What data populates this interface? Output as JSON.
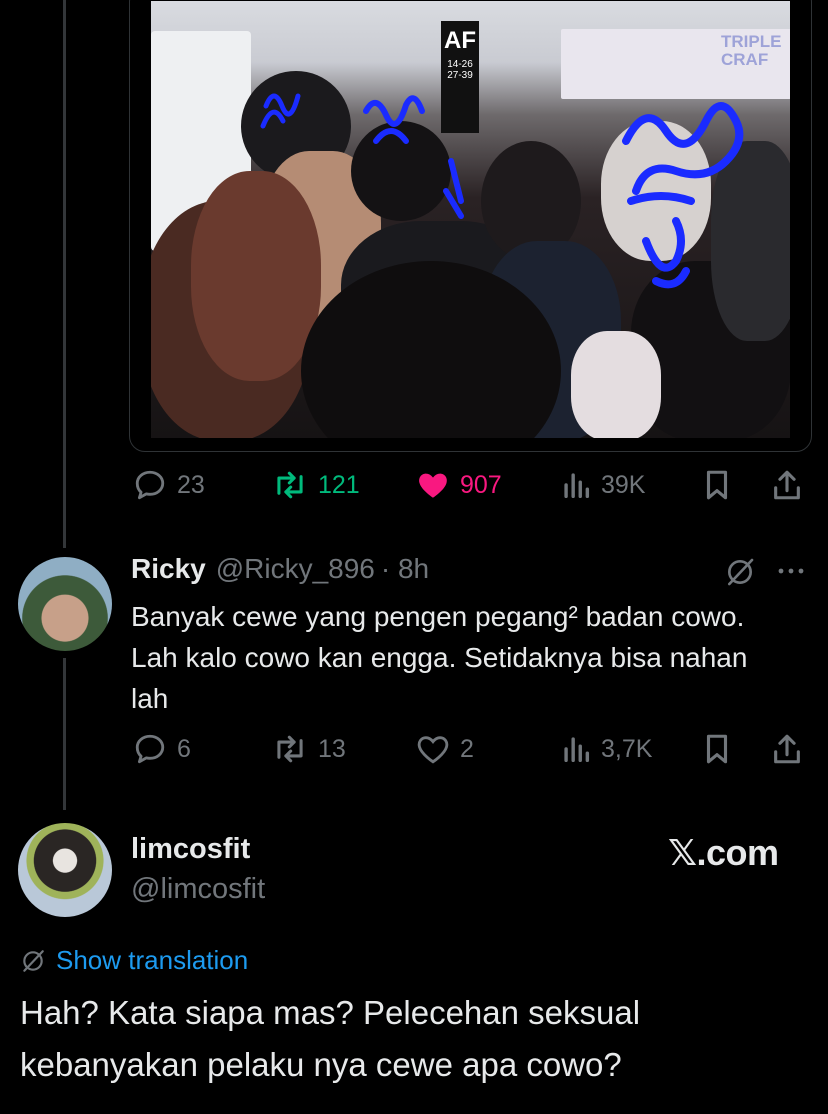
{
  "media": {
    "booth_sign_letters": "AF",
    "booth_sign_sub": "14-26 27-39",
    "banner_text": "TRIPLE CRAF"
  },
  "tweet_actions": {
    "replies": "23",
    "reposts": "121",
    "likes": "907",
    "views": "39K",
    "colors": {
      "repost": "#00ba7c",
      "like": "#f91880",
      "muted": "#71767b"
    }
  },
  "reply": {
    "name": "Ricky",
    "handle": "@Ricky_896",
    "time": "· 8h",
    "text": "Banyak cewe yang pengen pegang² badan cowo. Lah kalo cowo kan engga. Setidaknya bisa nahan lah",
    "actions": {
      "replies": "6",
      "reposts": "13",
      "likes": "2",
      "views": "3,7K"
    }
  },
  "main_tweet": {
    "name": "limcosfit",
    "handle": "@limcosfit",
    "source_badge": "𝕏.com",
    "translate_label": "Show translation",
    "text": "Hah? Kata siapa mas? Pelecehan seksual kebanyakan pelaku nya cewe apa cowo?"
  },
  "icons": [
    "reply-icon",
    "repost-icon",
    "heart-icon",
    "views-icon",
    "bookmark-icon",
    "share-icon",
    "grok-icon",
    "more-icon",
    "translate-icon"
  ]
}
